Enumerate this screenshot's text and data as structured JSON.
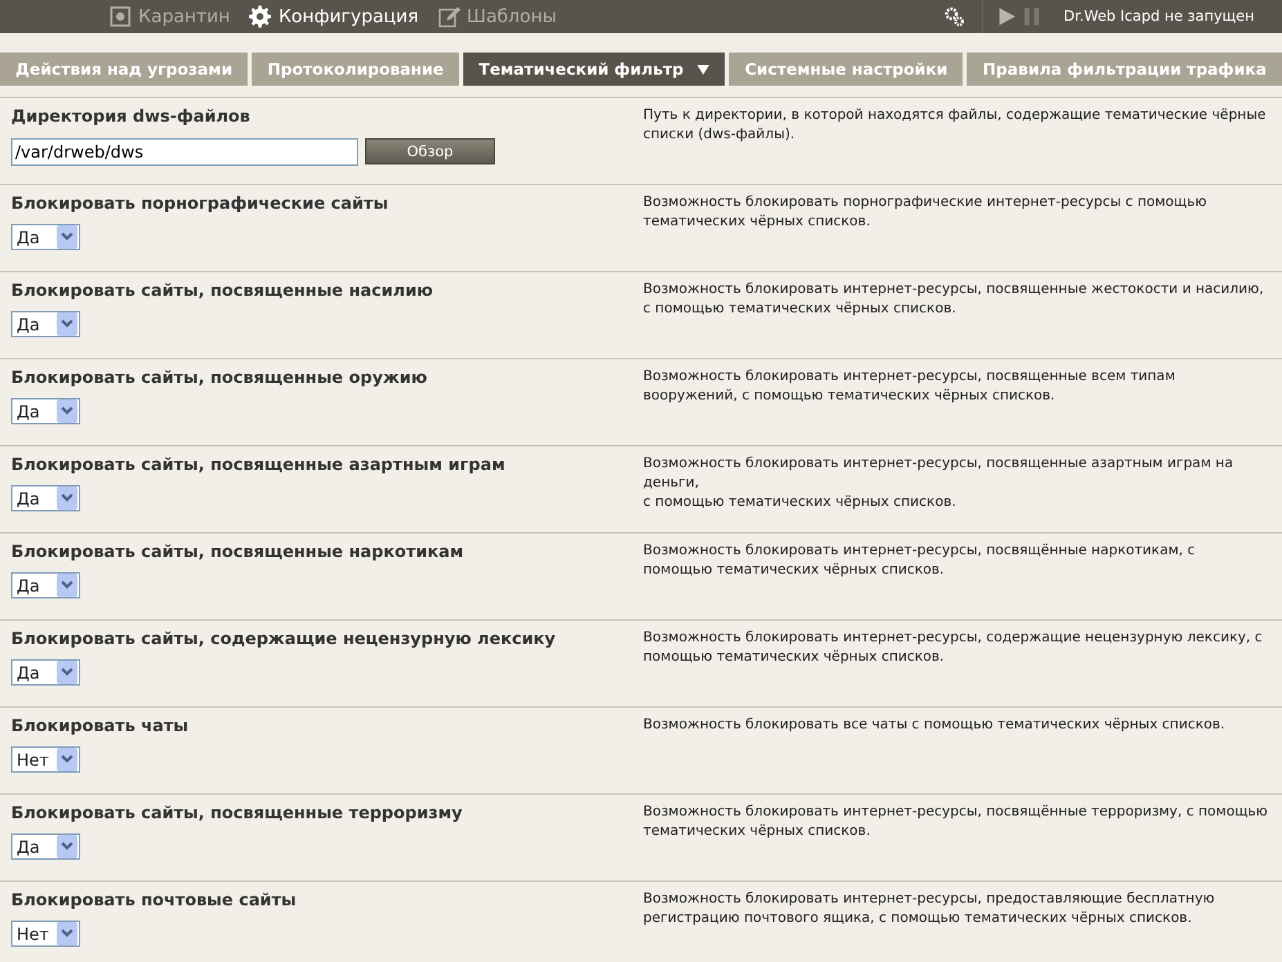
{
  "top_menu": [
    {
      "label": "Карантин",
      "kind": "quarantine",
      "selected": false
    },
    {
      "label": "Конфигурация",
      "kind": "gear",
      "selected": true
    },
    {
      "label": "Шаблоны",
      "kind": "template",
      "selected": false
    }
  ],
  "status": "Dr.Web Icapd не запущен",
  "tabs": [
    {
      "label": "Действия над угрозами",
      "selected": false
    },
    {
      "label": "Протоколирование",
      "selected": false
    },
    {
      "label": "Тематический фильтр",
      "selected": true
    },
    {
      "label": "Системные настройки",
      "selected": false
    },
    {
      "label": "Правила фильтрации трафика",
      "selected": false
    }
  ],
  "settings": [
    {
      "kind": "path",
      "label": "Директория dws-файлов",
      "value": "/var/drweb/dws",
      "button": "Обзор",
      "description": "Путь к директории, в которой находятся файлы, содержащие тематические чёрные списки (dws-файлы)."
    },
    {
      "kind": "select",
      "label": "Блокировать порнографические сайты",
      "value": "Да",
      "description": "Возможность блокировать порнографические интернет-ресурсы с помощью тематических чёрных списков."
    },
    {
      "kind": "select",
      "label": "Блокировать сайты, посвященные насилию",
      "value": "Да",
      "description": "Возможность блокировать интернет-ресурсы, посвященные жестокости и насилию, с помощью тематических чёрных списков."
    },
    {
      "kind": "select",
      "label": "Блокировать сайты, посвященные оружию",
      "value": "Да",
      "description": "Возможность блокировать интернет-ресурсы, посвященные всем типам вооружений, с помощью тематических чёрных списков."
    },
    {
      "kind": "select",
      "label": "Блокировать сайты, посвященные азартным играм",
      "value": "Да",
      "description": "Возможность блокировать интернет-ресурсы, посвященные азартным играм на деньги,\nс помощью тематических чёрных списков."
    },
    {
      "kind": "select",
      "label": "Блокировать сайты, посвященные наркотикам",
      "value": "Да",
      "description": "Возможность блокировать интернет-ресурсы, посвящённые наркотикам, с помощью тематических чёрных списков."
    },
    {
      "kind": "select",
      "label": "Блокировать сайты, содержащие нецензурную лексику",
      "value": "Да",
      "description": "Возможность блокировать интернет-ресурсы, содержащие нецензурную лексику, с помощью тематических чёрных списков."
    },
    {
      "kind": "select",
      "label": "Блокировать чаты",
      "value": "Нет",
      "description": "Возможность блокировать все чаты с помощью тематических чёрных списков."
    },
    {
      "kind": "select",
      "label": "Блокировать сайты, посвященные терроризму",
      "value": "Да",
      "description": "Возможность блокировать интернет-ресурсы, посвящённые терроризму, с помощью тематических чёрных списков."
    },
    {
      "kind": "select",
      "label": "Блокировать почтовые сайты",
      "value": "Нет",
      "description": "Возможность блокировать интернет-ресурсы, предоставляющие бесплатную регистрацию почтового ящика, с помощью тематических чёрных списков."
    }
  ]
}
